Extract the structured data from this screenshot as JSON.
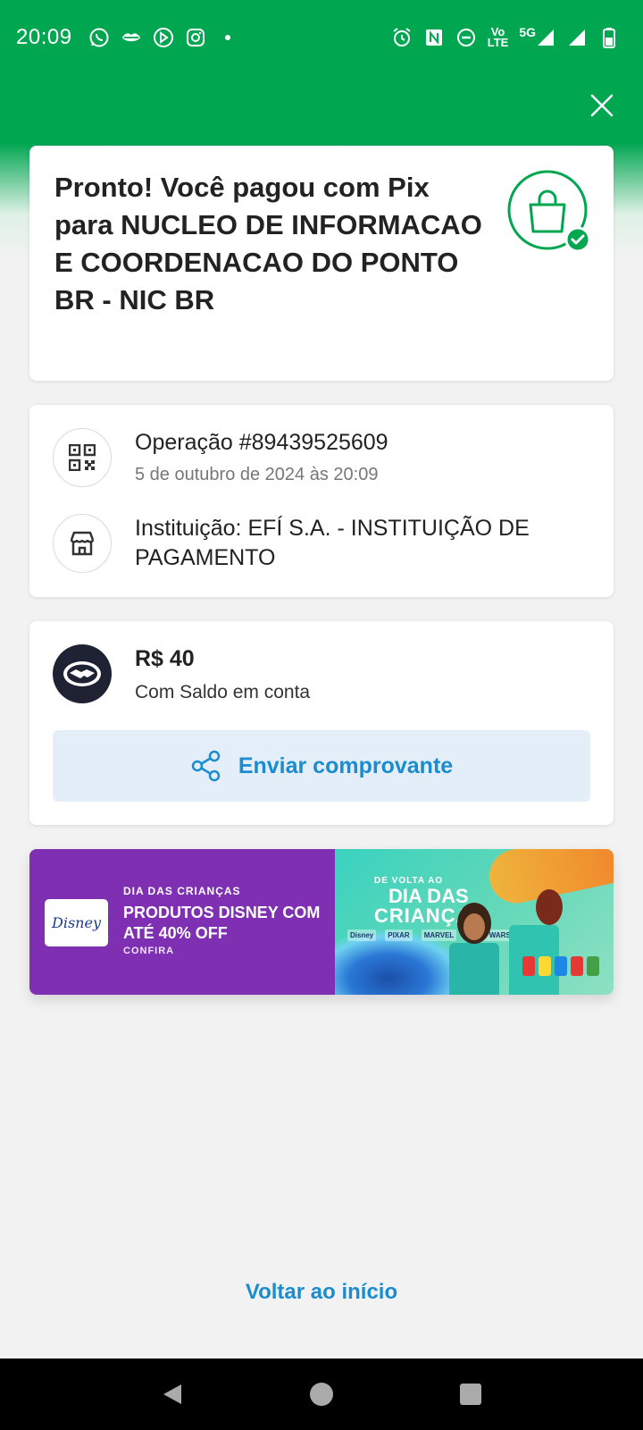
{
  "status_bar": {
    "time": "20:09",
    "network": "5G",
    "volte_top": "Vo",
    "volte_bottom": "LTE"
  },
  "receipt": {
    "title": "Pronto! Você pagou com Pix para NUCLEO DE INFORMACAO E COORDENACAO DO PONTO BR - NIC BR",
    "operation": "Operação #89439525609",
    "datetime": "5 de outubro de 2024 às 20:09",
    "institution": "Instituição: EFÍ S.A. - INSTITUIÇÃO DE PAGAMENTO",
    "amount": "R$ 40",
    "payment_method": "Com Saldo em conta",
    "share_button": "Enviar comprovante"
  },
  "banner": {
    "logo_text": "Disney",
    "kicker": "DIA DAS CRIANÇAS",
    "title": "PRODUTOS DISNEY COM ATÉ 40% OFF",
    "cta": "CONFIRA",
    "art_line1": "DE VOLTA AO",
    "art_line2": "DIA DAS",
    "art_line3": "CRIANÇAS",
    "art_brands": [
      "Disney",
      "PIXAR",
      "MARVEL",
      "STAR WARS"
    ]
  },
  "footer": {
    "home_link": "Voltar ao início"
  },
  "colors": {
    "brand_green": "#00a650",
    "link_blue": "#1a8ccf",
    "banner_purple": "#7e2fb2"
  },
  "icons": {
    "close": "close-icon",
    "bag": "shopping-bag-check-icon",
    "qr": "qr-code-icon",
    "store": "store-icon",
    "handshake": "handshake-icon",
    "share": "share-icon"
  }
}
